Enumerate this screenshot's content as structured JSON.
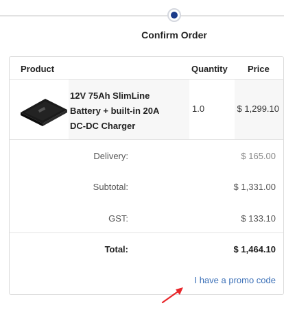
{
  "stepper": {
    "current_step_label": "Confirm Order"
  },
  "table": {
    "headers": {
      "product": "Product",
      "quantity": "Quantity",
      "price": "Price"
    },
    "items": [
      {
        "name": "12V 75Ah SlimLine\nBattery + built-in 20A\nDC-DC Charger",
        "quantity": "1.0",
        "price": "$ 1,299.10"
      }
    ]
  },
  "summary": {
    "delivery_label": "Delivery:",
    "delivery_value": "$ 165.00",
    "subtotal_label": "Subtotal:",
    "subtotal_value": "$ 1,331.00",
    "gst_label": "GST:",
    "gst_value": "$ 133.10",
    "total_label": "Total:",
    "total_value": "$ 1,464.10"
  },
  "promo": {
    "link_text": "I have a promo code"
  },
  "colors": {
    "accent": "#1b3b8a",
    "link": "#3a6fb7",
    "annotation_arrow": "#e8262a"
  }
}
